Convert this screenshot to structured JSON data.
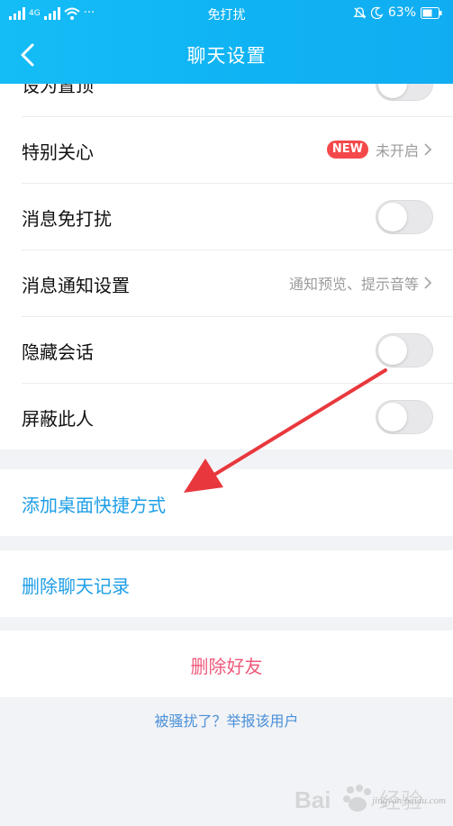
{
  "status_bar": {
    "left_text": "4G",
    "more": "···",
    "center": "免打扰",
    "battery": "63%"
  },
  "nav": {
    "title": "聊天设置"
  },
  "settings": [
    {
      "label": "设为置顶",
      "type": "toggle",
      "on": false
    },
    {
      "label": "特别关心",
      "type": "link",
      "badge": "NEW",
      "value": "未开启"
    },
    {
      "label": "消息免打扰",
      "type": "toggle",
      "on": false
    },
    {
      "label": "消息通知设置",
      "type": "link",
      "value": "通知预览、提示音等"
    },
    {
      "label": "隐藏会话",
      "type": "toggle",
      "on": false
    },
    {
      "label": "屏蔽此人",
      "type": "toggle",
      "on": false
    }
  ],
  "actions": {
    "add_shortcut": "添加桌面快捷方式",
    "clear_history": "删除聊天记录",
    "delete_friend": "删除好友",
    "report": "被骚扰了？举报该用户"
  },
  "watermark": {
    "brand": "Bai du 经验",
    "site": "jingyan.baidu.com"
  },
  "colors": {
    "header": "#12b4f4",
    "link": "#1e9ee6",
    "danger": "#f05a7a",
    "badge": "#f4484a",
    "annotation_arrow": "#e8383d"
  }
}
